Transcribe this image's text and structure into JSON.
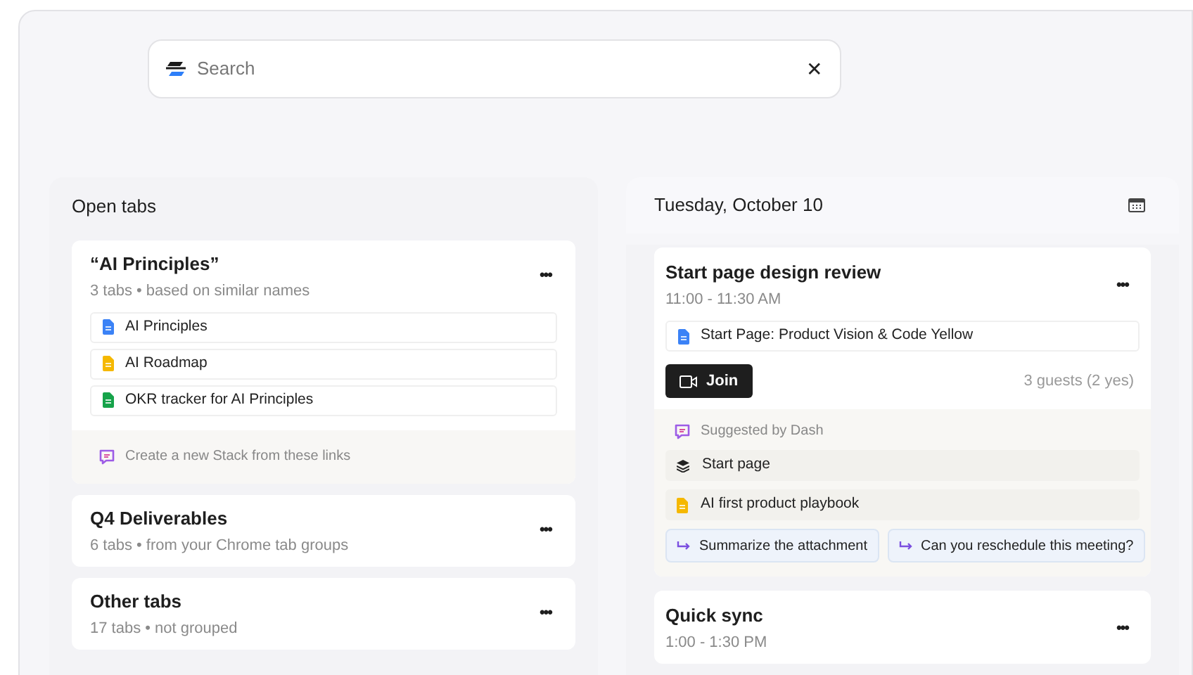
{
  "search": {
    "placeholder": "Search",
    "clear": "✕"
  },
  "open_tabs": {
    "title": "Open tabs",
    "groups": [
      {
        "title": "“AI Principles”",
        "subtitle": "3 tabs • based on similar names",
        "more": "•••",
        "items": [
          {
            "label": "AI Principles",
            "color": "#3b82f6"
          },
          {
            "label": "AI Roadmap",
            "color": "#f5b800"
          },
          {
            "label": "OKR tracker for AI Principles",
            "color": "#16a34a"
          }
        ],
        "suggestion": "Create a new Stack from these links"
      },
      {
        "title": "Q4 Deliverables",
        "subtitle": "6 tabs • from your Chrome tab groups",
        "more": "•••"
      },
      {
        "title": "Other tabs",
        "subtitle": "17 tabs • not grouped",
        "more": "•••"
      }
    ]
  },
  "calendar": {
    "date": "Tuesday, October 10",
    "events": [
      {
        "title": "Start page design review",
        "time": "11:00 - 11:30 AM",
        "more": "•••",
        "attachments": [
          {
            "label": "Start Page: Product Vision & Code Yellow",
            "color": "#3b82f6"
          }
        ],
        "join": "Join",
        "guests": "3 guests (2 yes)",
        "suggested": {
          "label": "Suggested by Dash",
          "items": [
            {
              "kind": "stack",
              "label": "Start page"
            },
            {
              "kind": "doc",
              "label": "AI first product playbook",
              "color": "#f5b800"
            }
          ],
          "prompts": [
            "Summarize the attachment",
            "Can you reschedule this meeting?"
          ]
        }
      },
      {
        "title": "Quick sync",
        "time": "1:00 - 1:30 PM",
        "more": "•••"
      }
    ]
  }
}
